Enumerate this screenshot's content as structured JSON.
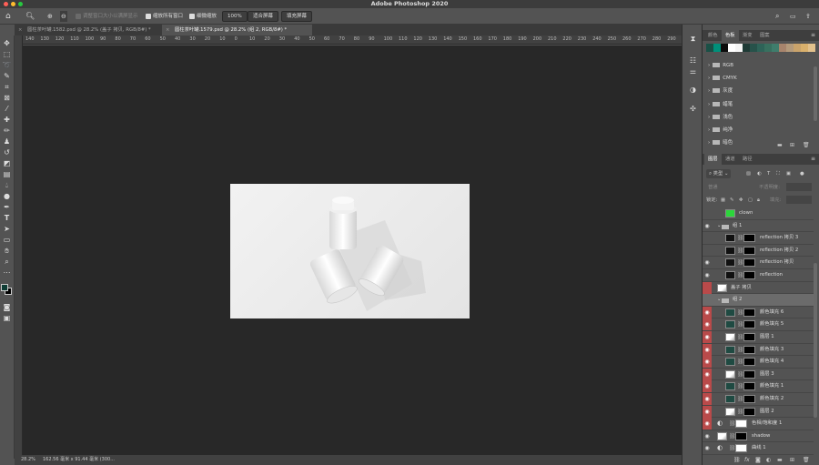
{
  "window": {
    "title": "Adobe Photoshop 2020"
  },
  "options": {
    "resize_label": "调整窗口大小以满屏显示",
    "zoom_all_label": "缩放所有窗口",
    "scrubby_label": "细微缩放",
    "zoom_value": "100%",
    "fit_label": "适合屏幕",
    "fill_label": "填充屏幕"
  },
  "tabs": [
    {
      "label": "圆柱茶叶罐.1582.psd @ 28.2% (盖子 拷贝, RGB/8#) *"
    },
    {
      "label": "圆柱茶叶罐.1579.psd @ 28.2% (组 2, RGB/8#) *"
    }
  ],
  "ruler": {
    "ticks": [
      "140",
      "130",
      "120",
      "110",
      "100",
      "90",
      "80",
      "70",
      "60",
      "50",
      "40",
      "30",
      "20",
      "10",
      "0",
      "10",
      "20",
      "30",
      "40",
      "50",
      "60",
      "70",
      "80",
      "90",
      "100",
      "110",
      "120",
      "130",
      "140",
      "150",
      "160",
      "170",
      "180",
      "190",
      "200",
      "210",
      "220",
      "230",
      "240",
      "250",
      "260",
      "270",
      "280",
      "290"
    ]
  },
  "status": {
    "zoom": "28.2%",
    "size": "162.56 毫米 x 91.44 毫米 (300..."
  },
  "swatches_panel": {
    "tabs": [
      {
        "label": "颜色"
      },
      {
        "label": "色板"
      },
      {
        "label": "渐变"
      },
      {
        "label": "图案"
      }
    ],
    "active_tab": "色板",
    "colors": [
      "#1a5046",
      "#00907a",
      "#0c0c0c",
      "#ffffff",
      "#f5f5f5",
      "#1f3b36",
      "#27524a",
      "#2e6358",
      "#38705f",
      "#3f7d6c",
      "#a7846c",
      "#b39a7b",
      "#c9a36b",
      "#d9b06c",
      "#e2c18c"
    ],
    "groups": [
      "RGB",
      "CMYK",
      "灰度",
      "蜡笔",
      "浅色",
      "纯净",
      "暗色"
    ]
  },
  "layers_panel": {
    "tabs": [
      {
        "label": "图层"
      },
      {
        "label": "通道"
      },
      {
        "label": "路径"
      }
    ],
    "filter_label": "类型",
    "blend_mode": "普通",
    "opacity_label": "不透明度:",
    "lock_label": "锁定:",
    "fill_label": "填充:",
    "layers": [
      {
        "name": "clown",
        "eye": "",
        "indent": 1,
        "kind": "green",
        "mask": false
      },
      {
        "name": "组 1",
        "eye": "◉",
        "indent": 0,
        "kind": "group",
        "mask": false
      },
      {
        "name": "reflection 拷贝 3",
        "eye": "",
        "indent": 1,
        "kind": "dark",
        "mask": true
      },
      {
        "name": "reflection 拷贝 2",
        "eye": "",
        "indent": 1,
        "kind": "dark",
        "mask": true
      },
      {
        "name": "reflection 拷贝",
        "eye": "◉",
        "indent": 1,
        "kind": "dark",
        "mask": true
      },
      {
        "name": "reflection",
        "eye": "◉",
        "indent": 1,
        "kind": "dark",
        "mask": true
      },
      {
        "name": "盖子 拷贝",
        "eye": "",
        "indent": 0,
        "kind": "smart",
        "mask": false,
        "red": true
      },
      {
        "name": "组 2",
        "eye": "",
        "indent": 0,
        "kind": "group",
        "mask": false,
        "sel": true
      },
      {
        "name": "颜色填充 6",
        "eye": "◉",
        "indent": 1,
        "kind": "teal",
        "mask": true,
        "red": true
      },
      {
        "name": "颜色填充 5",
        "eye": "◉",
        "indent": 1,
        "kind": "teal",
        "mask": true,
        "red": true
      },
      {
        "name": "图层 1",
        "eye": "◉",
        "indent": 1,
        "kind": "smart",
        "mask": true,
        "red": true
      },
      {
        "name": "颜色填充 3",
        "eye": "◉",
        "indent": 1,
        "kind": "teal",
        "mask": true,
        "red": true
      },
      {
        "name": "颜色填充 4",
        "eye": "◉",
        "indent": 1,
        "kind": "teal",
        "mask": true,
        "red": true
      },
      {
        "name": "图层 3",
        "eye": "◉",
        "indent": 1,
        "kind": "smart",
        "mask": true,
        "red": true
      },
      {
        "name": "颜色填充 1",
        "eye": "◉",
        "indent": 1,
        "kind": "teal",
        "mask": true,
        "red": true
      },
      {
        "name": "颜色填充 2",
        "eye": "◉",
        "indent": 1,
        "kind": "teal",
        "mask": true,
        "red": true
      },
      {
        "name": "图层 2",
        "eye": "◉",
        "indent": 1,
        "kind": "smart",
        "mask": true,
        "red": true
      },
      {
        "name": "色相/饱和度 1",
        "eye": "◉",
        "indent": 0,
        "kind": "adj",
        "mask": true,
        "red": true
      },
      {
        "name": "shadow",
        "eye": "◉",
        "indent": 0,
        "kind": "smart",
        "mask": true
      },
      {
        "name": "曲线 1",
        "eye": "◉",
        "indent": 0,
        "kind": "adj",
        "mask": true
      }
    ]
  }
}
